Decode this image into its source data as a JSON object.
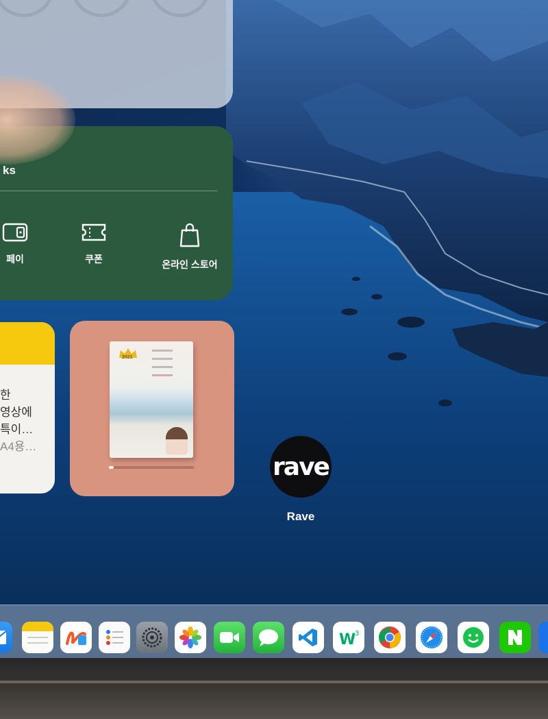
{
  "widgets": {
    "starbucks": {
      "title_partial": "ks",
      "items": [
        {
          "label": "페이",
          "icon": "wallet-icon"
        },
        {
          "label": "쿠폰",
          "icon": "ticket-icon"
        },
        {
          "label": "온라인 스토어",
          "icon": "shopping-bag-icon"
        }
      ]
    },
    "notes": {
      "lines": [
        "한",
        "영상에",
        "특이…",
        "A4용…"
      ]
    },
    "books": {
      "badge": "2021",
      "progress": 0.06
    }
  },
  "app": {
    "label": "Rave",
    "logo": "rave"
  },
  "dock": {
    "apps": [
      {
        "name": "mail",
        "icon": "mail-icon"
      },
      {
        "name": "notes",
        "icon": "notes-icon"
      },
      {
        "name": "freeform",
        "icon": "freeform-icon"
      },
      {
        "name": "reminders",
        "icon": "reminders-icon"
      },
      {
        "name": "settings",
        "icon": "gear-icon"
      },
      {
        "name": "photos",
        "icon": "photos-icon"
      },
      {
        "name": "facetime",
        "icon": "facetime-icon"
      },
      {
        "name": "messages",
        "icon": "messages-icon"
      },
      {
        "name": "vscode",
        "icon": "vscode-icon"
      },
      {
        "name": "w3",
        "icon": "w3-icon"
      },
      {
        "name": "chrome",
        "icon": "chrome-icon"
      },
      {
        "name": "safari",
        "icon": "safari-icon"
      },
      {
        "name": "smile",
        "icon": "smiley-icon"
      },
      {
        "name": "naver",
        "icon": "naver-icon"
      }
    ],
    "running_indicator": "safari"
  },
  "colors": {
    "starbucks_green": "#2c5a3e",
    "books_bg": "#d99480",
    "notes_yellow": "#f6c90e"
  }
}
